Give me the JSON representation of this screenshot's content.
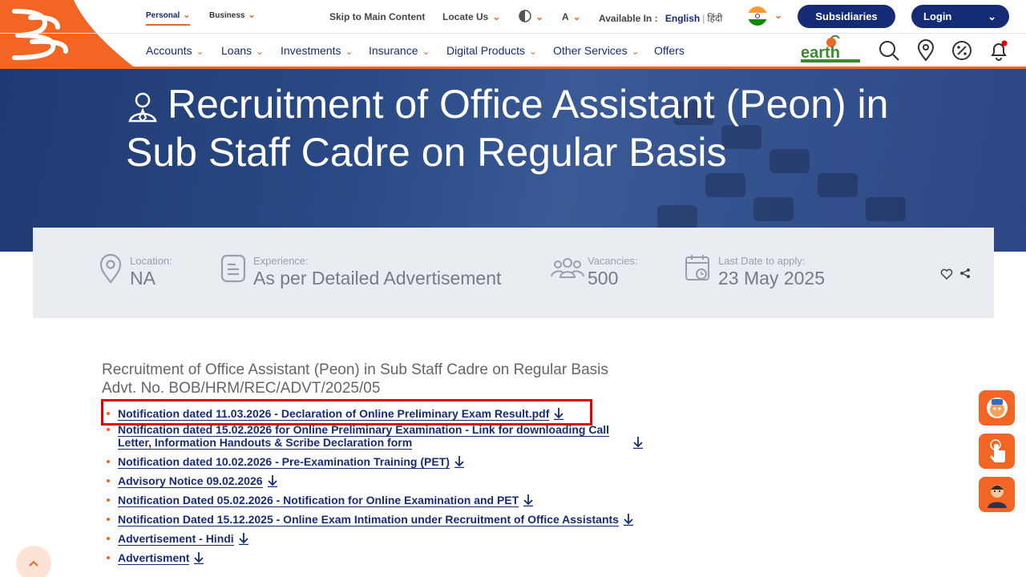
{
  "top_tabs": [
    {
      "label": "Personal",
      "active": true
    },
    {
      "label": "Business",
      "active": false
    }
  ],
  "utilities": {
    "skip": "Skip to Main Content",
    "locate": "Locate Us",
    "font_size": "A",
    "available_in": "Available In :",
    "english": "English",
    "hindi": "हिंदी",
    "subsidiaries": "Subsidiaries",
    "login": "Login"
  },
  "nav": [
    {
      "label": "Accounts"
    },
    {
      "label": "Loans"
    },
    {
      "label": "Investments"
    },
    {
      "label": "Insurance"
    },
    {
      "label": "Digital Products"
    },
    {
      "label": "Other Services"
    },
    {
      "label": "Offers"
    }
  ],
  "banner": {
    "title": "Recruitment of Office Assistant (Peon) in Sub Staff Cadre on Regular Basis"
  },
  "info": {
    "location_label": "Location:",
    "location_value": "NA",
    "experience_label": "Experience:",
    "experience_value": "As per Detailed Advertisement",
    "vacancies_label": "Vacancies:",
    "vacancies_value": "500",
    "last_date_label": "Last Date to apply:",
    "last_date_value": "23 May 2025"
  },
  "content": {
    "heading": "Recruitment of Office Assistant (Peon) in Sub Staff Cadre on Regular Basis",
    "advt_no": "Advt. No. BOB/HRM/REC/ADVT/2025/05",
    "documents": [
      "Notification dated 11.03.2026 - Declaration of Online Preliminary Exam Result.pdf",
      "Notification dated 15.02.2026 for Online Preliminary Examination - Link for downloading Call Letter, Information Handouts & Scribe Declaration form",
      "Notification dated 10.02.2026 - Pre-Examination Training (PET)",
      "Advisory Notice 09.02.2026",
      "Notification Dated 05.02.2026 - Notification for Online Examination and PET",
      "Notification Dated 15.12.2025 - Online Exam Intimation under Recruitment of Office Assistants",
      "Advertisement - Hindi",
      "Advertisment"
    ]
  },
  "colors": {
    "brand_orange": "#f26522",
    "brand_navy": "#162b75",
    "highlight": "#e00000"
  }
}
